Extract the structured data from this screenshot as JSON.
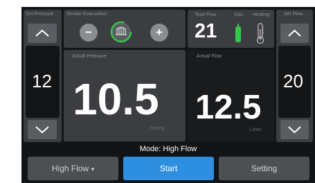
{
  "set_pressure": {
    "label": "Set Pressure",
    "value": "12"
  },
  "smoke_evacuation": {
    "label": "Smoke Evacuation",
    "minus": "−",
    "plus": "+"
  },
  "total_flow": {
    "label": "Total Flow",
    "value": "21"
  },
  "gas": {
    "label": "Gas"
  },
  "heating": {
    "label": "Heating"
  },
  "set_flow": {
    "label": "Set Flow",
    "value": "20"
  },
  "actual_pressure": {
    "label": "Actual Pressure",
    "value": "10.5",
    "unit": "mmHg"
  },
  "actual_flow": {
    "label": "Actual Flow",
    "value": "12.5",
    "unit": "L/min"
  },
  "mode": {
    "text": "Mode: High Flow"
  },
  "buttons": {
    "mode_select": "High Flow",
    "mode_caret": "▾",
    "start": "Start",
    "setting": "Setting"
  },
  "colors": {
    "background": "#131415",
    "panel": "#3b3d40",
    "accent_green": "#34c94a",
    "start_blue": "#2e8fe0"
  },
  "icons": [
    "chevron-up-icon",
    "chevron-down-icon",
    "fan-icon",
    "gas-cylinder-icon",
    "thermometer-icon"
  ]
}
